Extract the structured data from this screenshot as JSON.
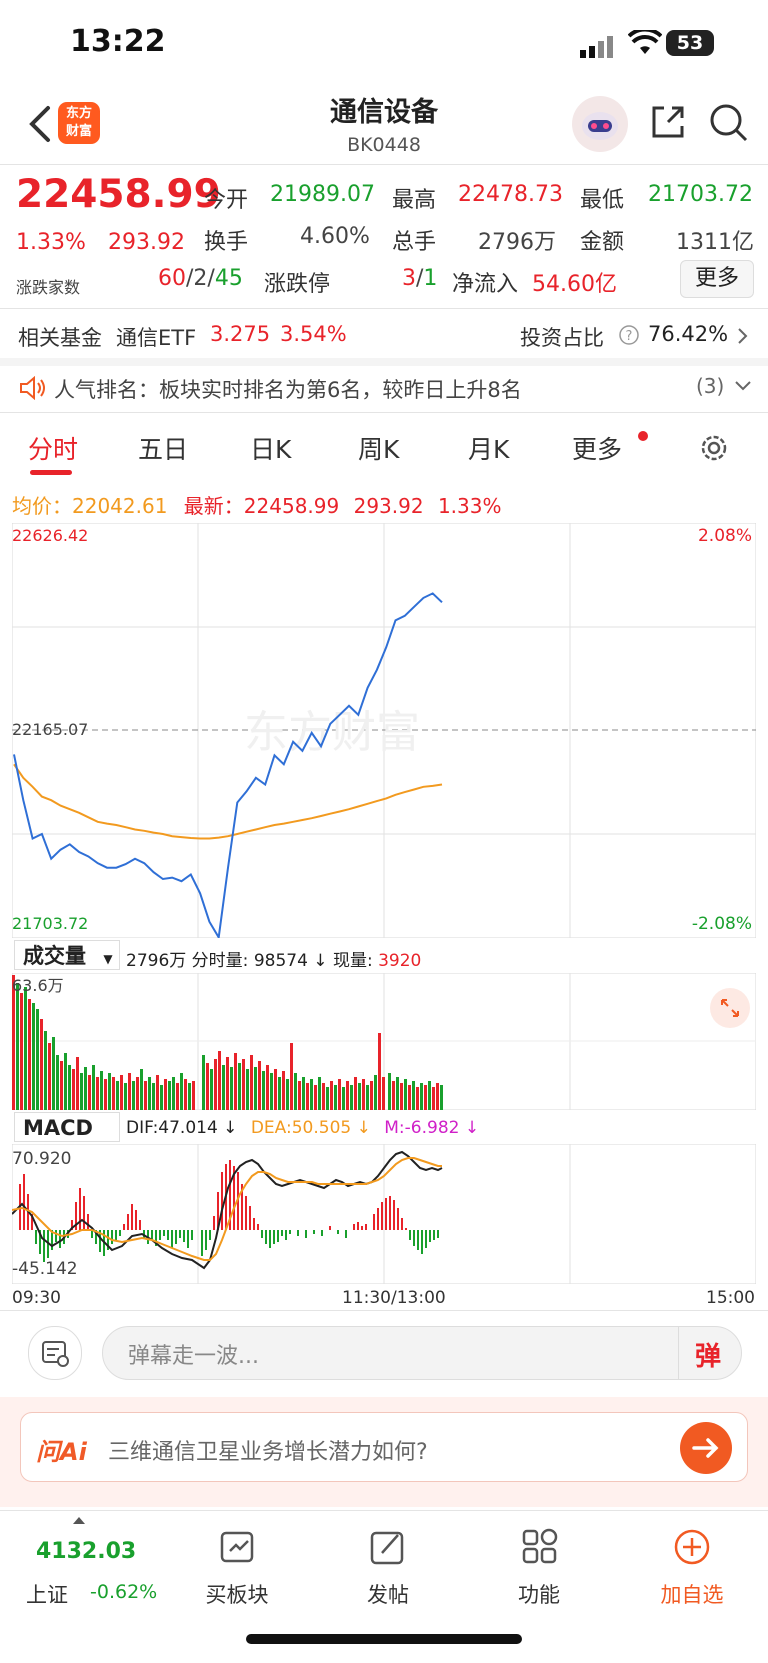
{
  "status": {
    "time": "13:22",
    "battery": "53"
  },
  "header": {
    "logo": [
      "东方",
      "财富"
    ],
    "title": "通信设备",
    "code": "BK0448"
  },
  "quote": {
    "price": "22458.99",
    "change_pct": "1.33%",
    "change": "293.92",
    "open_label": "今开",
    "open": "21989.07",
    "high_label": "最高",
    "high": "22478.73",
    "low_label": "最低",
    "low": "21703.72",
    "turnover_label": "换手",
    "turnover": "4.60%",
    "volume_label": "总手",
    "volume": "2796万",
    "amount_label": "金额",
    "amount": "1311亿",
    "updown_label": "涨跌家数",
    "up_count": "60",
    "flat_count": "2",
    "down_count": "45",
    "limit_label": "涨跌停",
    "limit_up": "3",
    "limit_down": "1",
    "netflow_label": "净流入",
    "netflow": "54.60亿",
    "more_label": "更多"
  },
  "fund": {
    "label": "相关基金",
    "name": "通信ETF",
    "price": "3.275",
    "pct": "3.54%",
    "invest_label": "投资占比",
    "invest_pct": "76.42%"
  },
  "rank": {
    "text": "人气排名：板块实时排名为第6名，较昨日上升8名",
    "count": "(3)"
  },
  "tabs": [
    "分时",
    "五日",
    "日K",
    "周K",
    "月K",
    "更多"
  ],
  "intraday": {
    "avg_label": "均价：",
    "avg": "22042.61",
    "latest_label": "最新：",
    "latest": "22458.99",
    "latest_change": "293.92",
    "latest_pct": "1.33%",
    "y_top": "22626.42",
    "y_mid": "22165.07",
    "y_bottom": "21703.72",
    "pct_top": "2.08%",
    "pct_bottom": "-2.08%",
    "watermark": "东方财富"
  },
  "volume": {
    "select": "成交量",
    "total": "2796万",
    "fen_label": "分时量:",
    "fen": "98574 ↓",
    "now_label": "现量:",
    "now": "3920",
    "max_label": "63.6万"
  },
  "macd": {
    "select": "MACD",
    "dif": "DIF:47.014 ↓",
    "dea": "DEA:50.505 ↓",
    "m": "M:-6.982 ↓",
    "top": "70.920",
    "bottom": "-45.142",
    "time_start": "09:30",
    "time_mid": "11:30/13:00",
    "time_end": "15:00"
  },
  "danmu": {
    "placeholder": "弹幕走一波...",
    "send": "弹"
  },
  "ai": {
    "logo": "问Ai",
    "question": "三维通信卫星业务增长潜力如何?"
  },
  "bottom_nav": {
    "index_value": "4132.03",
    "index_name": "上证",
    "index_pct": "-0.62%",
    "items": [
      "买板块",
      "发帖",
      "功能",
      "加自选"
    ]
  },
  "colors": {
    "up": "#e8232a",
    "down": "#19a02d",
    "price_line": "#2f6fd6",
    "avg_line": "#f29a1f",
    "accent": "#f15a22"
  },
  "chart_data": {
    "type": "line",
    "y_range": [
      21703.72,
      22626.42
    ],
    "base": 22165.07,
    "series": [
      {
        "values": [
          22112,
          22010,
          21925,
          21935,
          21880,
          21900,
          21912,
          21895,
          21885,
          21870,
          21860,
          21860,
          21868,
          21880,
          21870,
          21850,
          21835,
          21838,
          21830,
          21845,
          21803,
          21740,
          21705,
          21860,
          22005,
          22030,
          22060,
          22045,
          22110,
          22090,
          22140,
          22120,
          22160,
          22130,
          22180,
          22200,
          22220,
          22200,
          22260,
          22300,
          22350,
          22410,
          22420,
          22440,
          22460,
          22470,
          22450
        ]
      },
      {
        "values": [
          22090,
          22060,
          22040,
          22018,
          22010,
          21998,
          21990,
          21982,
          21972,
          21962,
          21958,
          21955,
          21950,
          21945,
          21942,
          21938,
          21935,
          21930,
          21928,
          21926,
          21925,
          21925,
          21927,
          21930,
          21935,
          21940,
          21945,
          21950,
          21955,
          21958,
          21962,
          21966,
          21970,
          21975,
          21980,
          21985,
          21990,
          21996,
          22002,
          22008,
          22014,
          22022,
          22028,
          22034,
          22040,
          22042,
          22045
        ]
      }
    ]
  }
}
